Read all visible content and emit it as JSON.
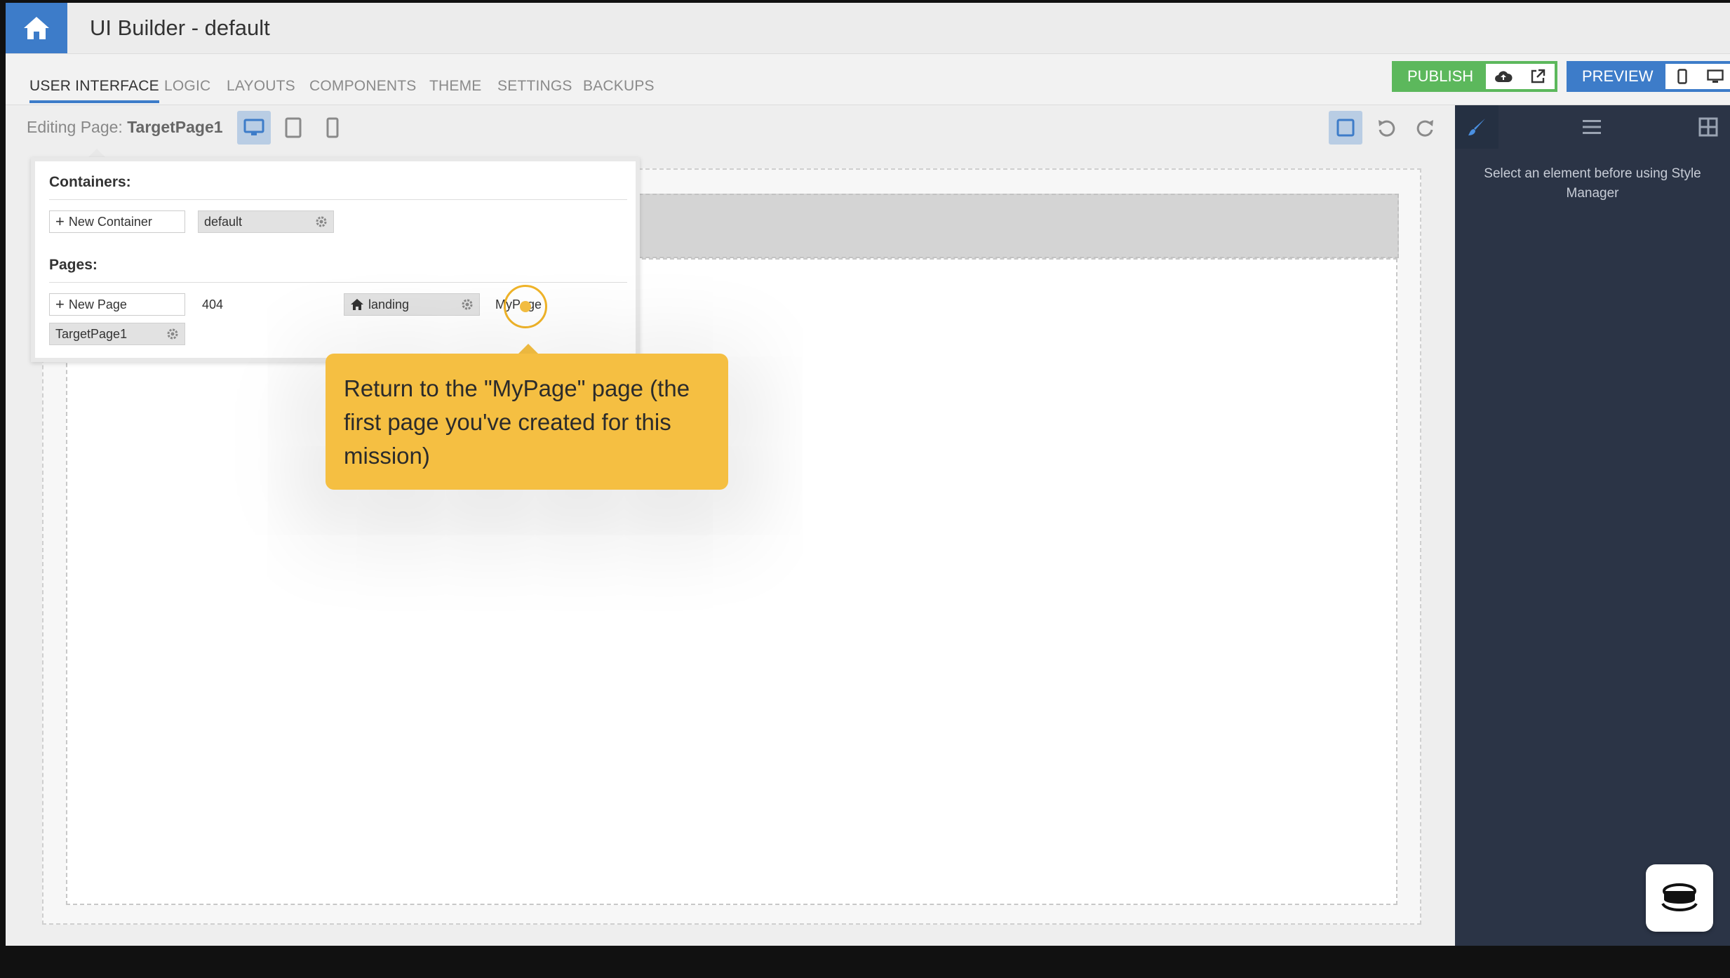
{
  "header": {
    "title": "UI Builder - default",
    "home_icon": "home-icon"
  },
  "nav": {
    "tabs": [
      {
        "label": "USER INTERFACE",
        "active": true
      },
      {
        "label": "LOGIC"
      },
      {
        "label": "LAYOUTS"
      },
      {
        "label": "COMPONENTS"
      },
      {
        "label": "THEME"
      },
      {
        "label": "SETTINGS"
      },
      {
        "label": "BACKUPS"
      }
    ],
    "publish": {
      "label": "PUBLISH",
      "color": "#5cb85c"
    },
    "preview": {
      "label": "PREVIEW",
      "color": "#3d7cc9"
    }
  },
  "toolbar": {
    "editing_prefix": "Editing Page: ",
    "editing_page": "TargetPage1"
  },
  "popover": {
    "containers_heading": "Containers:",
    "new_container_label": "New Container",
    "containers": [
      {
        "name": "default"
      }
    ],
    "pages_heading": "Pages:",
    "new_page_label": "New Page",
    "pages": [
      {
        "name": "404"
      },
      {
        "name": "landing",
        "home": true
      },
      {
        "name": "MyPage"
      },
      {
        "name": "TargetPage1"
      }
    ]
  },
  "tooltip": {
    "text": "Return to the \"MyPage\" page (the first page you've created for this mission)",
    "color": "#f5bf42"
  },
  "right_panel": {
    "message": "Select an element before using Style Manager"
  },
  "colors": {
    "accent": "#3d7cc9",
    "panel_bg": "#2b3446"
  }
}
